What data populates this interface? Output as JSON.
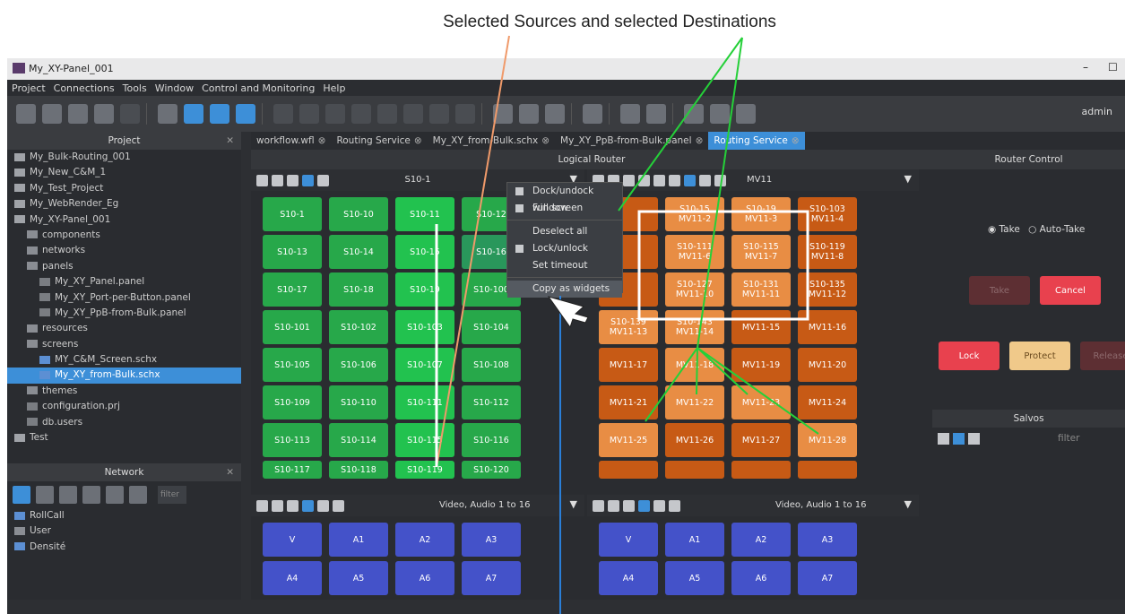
{
  "annotation": {
    "title": "Selected Sources and selected Destinations"
  },
  "window": {
    "title": "My_XY-Panel_001",
    "user": "admin"
  },
  "menu": [
    "Project",
    "Connections",
    "Tools",
    "Window",
    "Control and Monitoring",
    "Help"
  ],
  "project": {
    "header": "Project",
    "items": [
      {
        "label": "My_Bulk-Routing_001",
        "indent": 0,
        "icon": "p"
      },
      {
        "label": "My_New_C&M_1",
        "indent": 0,
        "icon": "p"
      },
      {
        "label": "My_Test_Project",
        "indent": 0,
        "icon": "p"
      },
      {
        "label": "My_WebRender_Eg",
        "indent": 0,
        "icon": "p"
      },
      {
        "label": "My_XY-Panel_001",
        "indent": 0,
        "icon": "p"
      },
      {
        "label": "components",
        "indent": 1,
        "icon": "f"
      },
      {
        "label": "networks",
        "indent": 1,
        "icon": "f"
      },
      {
        "label": "panels",
        "indent": 1,
        "icon": "f"
      },
      {
        "label": "My_XY_Panel.panel",
        "indent": 2,
        "icon": "s"
      },
      {
        "label": "My_XY_Port-per-Button.panel",
        "indent": 2,
        "icon": "s"
      },
      {
        "label": "My_XY_PpB-from-Bulk.panel",
        "indent": 2,
        "icon": "s"
      },
      {
        "label": "resources",
        "indent": 1,
        "icon": "f"
      },
      {
        "label": "screens",
        "indent": 1,
        "icon": "f"
      },
      {
        "label": "MY_C&M_Screen.schx",
        "indent": 2,
        "icon": "sc"
      },
      {
        "label": "My_XY_from-Bulk.schx",
        "indent": 2,
        "icon": "sc"
      },
      {
        "label": "themes",
        "indent": 1,
        "icon": "f"
      },
      {
        "label": "configuration.prj",
        "indent": 1,
        "icon": "s"
      },
      {
        "label": "db.users",
        "indent": 1,
        "icon": "s"
      },
      {
        "label": "Test",
        "indent": 0,
        "icon": "p"
      }
    ]
  },
  "network": {
    "header": "Network",
    "filter": "filter",
    "items": [
      "RollCall",
      "User",
      "Densité"
    ]
  },
  "tabs": [
    {
      "label": "workflow.wfl",
      "active": false
    },
    {
      "label": "Routing Service",
      "active": false
    },
    {
      "label": "My_XY_from-Bulk.schx",
      "active": false
    },
    {
      "label": "My_XY_PpB-from-Bulk.panel",
      "active": false
    },
    {
      "label": "Routing Service",
      "active": true
    }
  ],
  "logical_router": {
    "title": "Logical Router",
    "source_header": "S10-1",
    "dest_header": "MV11",
    "sources": [
      "S10-1",
      "S10-10",
      "S10-11",
      "S10-12",
      "S10-13",
      "S10-14",
      "S10-15",
      "S10-16",
      "S10-17",
      "S10-18",
      "S10-19",
      "S10-100",
      "S10-101",
      "S10-102",
      "S10-103",
      "S10-104",
      "S10-105",
      "S10-106",
      "S10-107",
      "S10-108",
      "S10-109",
      "S10-110",
      "S10-111",
      "S10-112",
      "S10-113",
      "S10-114",
      "S10-115",
      "S10-116",
      "S10-117",
      "S10-118",
      "S10-119",
      "S10-120"
    ],
    "destinations": [
      {
        "src": "",
        "dst": ""
      },
      {
        "src": "S10-15",
        "dst": "MV11-2"
      },
      {
        "src": "S10-19",
        "dst": "MV11-3"
      },
      {
        "src": "S10-103",
        "dst": "MV11-4"
      },
      {
        "src": "",
        "dst": ""
      },
      {
        "src": "S10-111",
        "dst": "MV11-6"
      },
      {
        "src": "S10-115",
        "dst": "MV11-7"
      },
      {
        "src": "S10-119",
        "dst": "MV11-8"
      },
      {
        "src": "",
        "dst": ""
      },
      {
        "src": "S10-127",
        "dst": "MV11-10"
      },
      {
        "src": "S10-131",
        "dst": "MV11-11"
      },
      {
        "src": "S10-135",
        "dst": "MV11-12"
      },
      {
        "src": "S10-139",
        "dst": "MV11-13"
      },
      {
        "src": "S10-143",
        "dst": "MV11-14"
      },
      {
        "src": "",
        "dst": "MV11-15"
      },
      {
        "src": "",
        "dst": "MV11-16"
      },
      {
        "src": "",
        "dst": "MV11-17"
      },
      {
        "src": "",
        "dst": "MV11-18"
      },
      {
        "src": "",
        "dst": "MV11-19"
      },
      {
        "src": "",
        "dst": "MV11-20"
      },
      {
        "src": "",
        "dst": "MV11-21"
      },
      {
        "src": "",
        "dst": "MV11-22"
      },
      {
        "src": "",
        "dst": "MV11-23"
      },
      {
        "src": "",
        "dst": "MV11-24"
      },
      {
        "src": "",
        "dst": "MV11-25"
      },
      {
        "src": "",
        "dst": "MV11-26"
      },
      {
        "src": "",
        "dst": "MV11-27"
      },
      {
        "src": "",
        "dst": "MV11-28"
      }
    ],
    "selected_dest_numbers": [
      "MV11-2",
      "MV11-3",
      "MV11-6",
      "MV11-7",
      "MV11-10",
      "MV11-11",
      "MV11-13",
      "MV11-14",
      "MV11-18",
      "MV11-22",
      "MV11-23",
      "MV11-25",
      "MV11-28"
    ],
    "level_header": "Video, Audio 1 to 16",
    "levels": [
      "V",
      "A1",
      "A2",
      "A3",
      "A4",
      "A5",
      "A6",
      "A7"
    ]
  },
  "context_menu": {
    "items": [
      "Dock/undock window",
      "Full screen",
      "Deselect all",
      "Lock/unlock",
      "Set timeout",
      "Copy as widgets"
    ],
    "highlighted": "Copy as widgets"
  },
  "router_control": {
    "title": "Router Control",
    "take_label": "Take",
    "auto_take_label": "Auto-Take",
    "take_button": "Take",
    "cancel_button": "Cancel",
    "lock_button": "Lock",
    "protect_button": "Protect",
    "release_button": "Release",
    "salvos_title": "Salvos",
    "salvos_filter": "filter"
  },
  "colors": {
    "source": "#27a84a",
    "source_selected": "#22c24f",
    "dest": "#c75a15",
    "dest_selected": "#e88d44",
    "level": "#4452c9",
    "accent": "#3d8fd8"
  }
}
